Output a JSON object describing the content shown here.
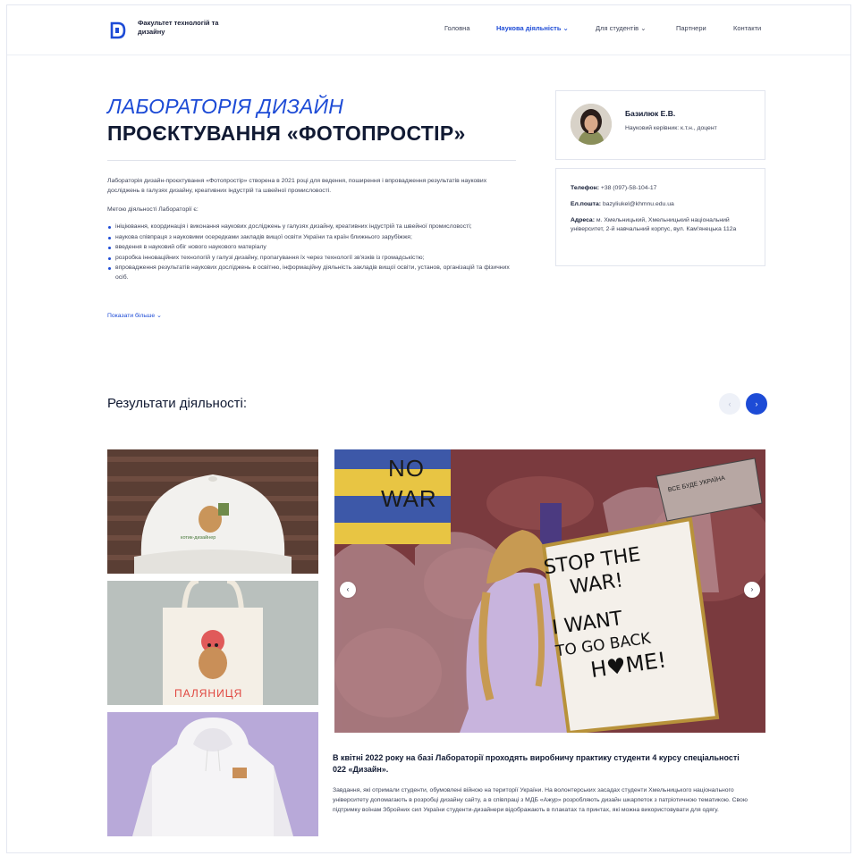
{
  "header": {
    "brand": "Факультет технологій та дизайну",
    "nav": [
      {
        "label": "Головна",
        "active": false
      },
      {
        "label": "Наукова діяльність ⌄",
        "active": true
      },
      {
        "label": "Для студентів ⌄",
        "active": false
      },
      {
        "label": "Партнери",
        "active": false
      },
      {
        "label": "Контакти",
        "active": false
      }
    ]
  },
  "hero": {
    "title_line1": "ЛАБОРАТОРІЯ ДИЗАЙН",
    "title_line2": "ПРОЄКТУВАННЯ «ФОТОПРОСТІР»",
    "intro": "Лабораторія дизайн-проєктування «Фотопростір» створена в 2021 році для ведення, поширення і впровадження результатів наукових досліджень в галузях дизайну, креативних індустрій та швейної промисловості.",
    "goal_heading": "Метою діяльності Лабораторії є:",
    "goals": [
      "ініціювання, координація і виконання наукових досліджень у галузях дизайну, креативних індустрій та швейної промисловості;",
      "наукова співпраця з науковими осередками закладів вищої освіти України та країн ближнього зарубіжжя;",
      "введення в науковий обіг нового наукового матеріалу",
      "розробка інноваційних технологій у галузі дизайну, пропагування їх через технології зв'язків із громадськістю;",
      "впровадження результатів наукових досліджень в освітню, інформаційну діяльність закладів вищої освіти, установ, організацій та фізичних осіб."
    ],
    "show_more": "Показати більше ⌄"
  },
  "supervisor": {
    "name": "Базилюк Е.В.",
    "role": "Науковий керівник: к.т.н., доцент"
  },
  "contacts": {
    "phone_label": "Телефон:",
    "phone": "+38 (097)-58-104-17",
    "email_label": "Ел.пошта:",
    "email": "bazyliukel@khmnu.edu.ua",
    "address_label": "Адреса:",
    "address": "м. Хмельницький, Хмельницький національний університет, 2-й навчальний корпус, вул. Кам'янецька 112а"
  },
  "results": {
    "title": "Результати діяльності:",
    "prev_icon": "‹",
    "next_icon": "›"
  },
  "poster": {
    "no_war": "NO",
    "war": "WAR",
    "sign_small": "ВСЕ БУДЕ УКРАЇНА",
    "sign_line1": "STOP THE",
    "sign_line2": "WAR!",
    "sign_line3": "I WANT",
    "sign_line4": "TO GO BACK",
    "sign_line5": "H♥ME!"
  },
  "thumbs": {
    "cap_text": "котик-дизайнер",
    "bag_text": "ПАЛЯНИЦЯ"
  },
  "news": {
    "title": "В квітні 2022 року на базі Лабораторії проходять виробничу практику студенти 4 курсу спеціальності 022 «Дизайн».",
    "body": "Завдання, які отримали студенти, обумовлені війною на території України. На волонтерських засадах студенти Хмельницького національного університету допомагають в розробці дизайну сайту, а в співпраці з МДБ «Ажур» розробляють дизайн шкарпеток з патріотичною тематикою. Свою підтримку воїнам Збройних сил України студенти-дизайнери відображають в плакатах та принтах, які можна використовувати для одягу."
  },
  "colors": {
    "accent": "#1d4bd6",
    "text": "#111a33"
  }
}
